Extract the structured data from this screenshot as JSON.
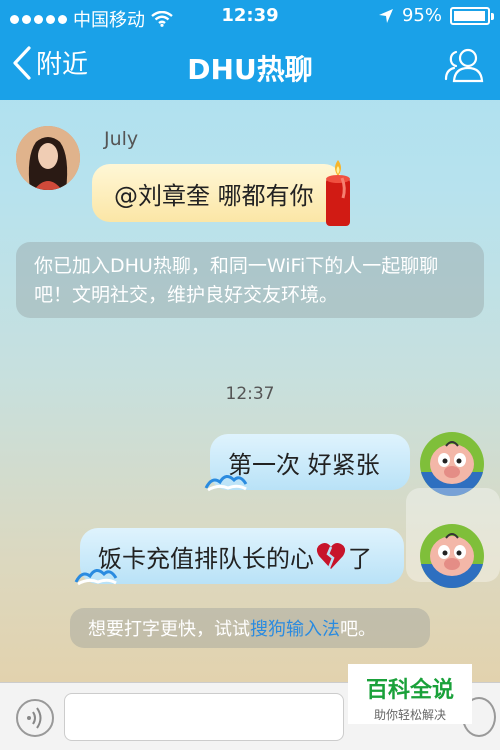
{
  "status_bar": {
    "carrier": "中国移动",
    "time": "12:39",
    "battery": "95%"
  },
  "nav": {
    "back_label": "附近",
    "title": "DHU热聊"
  },
  "messages": [
    {
      "sender": "July",
      "text": "@刘章奎 哪都有你"
    },
    {
      "type": "system",
      "text": "你已加入DHU热聊，和同一WiFi下的人一起聊聊吧！文明社交，维护良好交友环境。"
    },
    {
      "type": "timestamp",
      "text": "12:37"
    },
    {
      "sender": "self",
      "text": "第一次 好紧张"
    },
    {
      "sender": "self",
      "text": "饭卡充值排队长的心",
      "suffix": "了"
    }
  ],
  "tip": {
    "prefix": "想要打字更快，试试",
    "link": "搜狗输入法",
    "suffix": "吧。"
  },
  "watermark": {
    "title": "百科全说",
    "subtitle": "助你轻松解决"
  },
  "colors": {
    "nav_bg": "#1aa1e8",
    "link": "#2a8be0"
  }
}
